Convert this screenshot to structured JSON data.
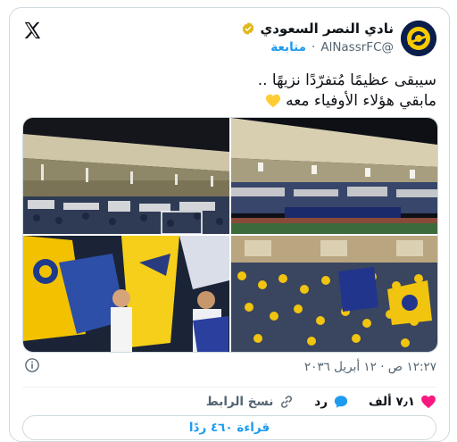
{
  "account": {
    "name": "نادي النصر السعودي",
    "handle": "@AlNassrFC",
    "follow_label": "متابعة",
    "separator": "·"
  },
  "tweet": {
    "line1": "سيبقى عظيمًا مُتفرّدًا نزيهًا ..",
    "line2": "مابقي هؤلاء الأوفياء معه"
  },
  "timestamp": "١٢:٢٧ ص · ١٢ أبريل ٢٠٣٦",
  "actions": {
    "likes_count": "٧٫١ ألف",
    "reply_label": "رد",
    "copy_link_label": "نسخ الرابط"
  },
  "read_replies_label": "قراءة ٤٦٠ ردًا",
  "colors": {
    "accent": "#1d9bf0",
    "like": "#f91880",
    "brand_yellow": "#f6c900",
    "brand_navy": "#0b1d4a"
  },
  "icons": [
    "x-logo-icon",
    "verified-badge-icon",
    "yellow-heart-icon",
    "info-icon",
    "heart-icon",
    "reply-icon",
    "link-icon"
  ]
}
